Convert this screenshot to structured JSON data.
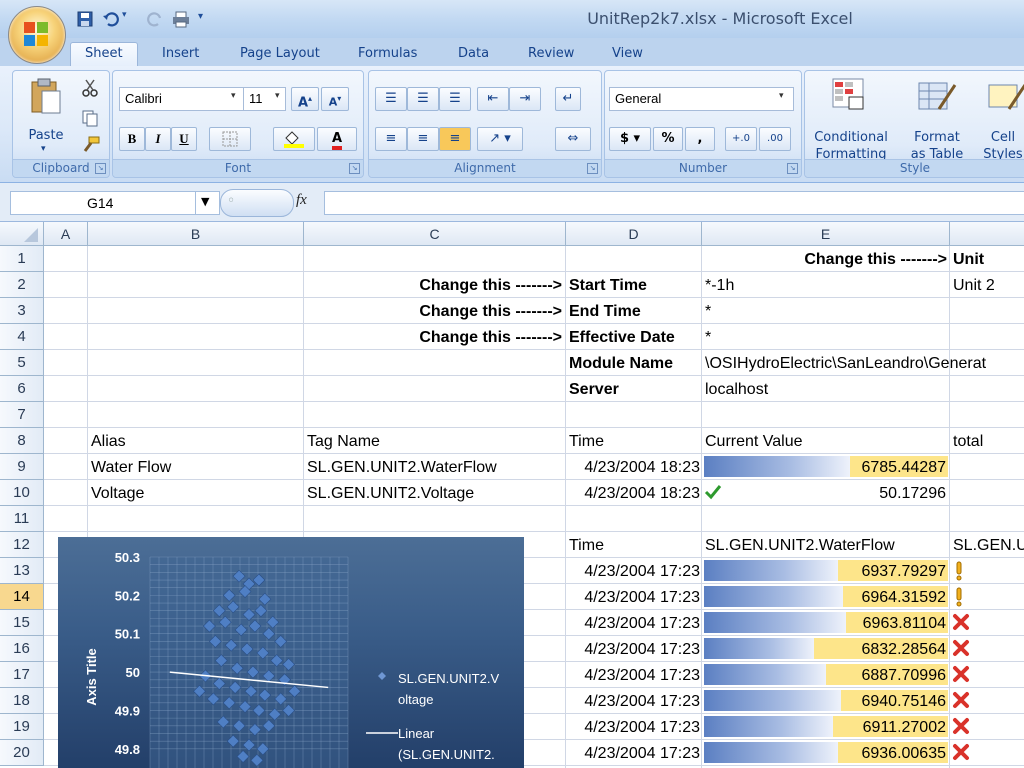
{
  "window": {
    "title": "UnitRep2k7.xlsx - Microsoft Excel"
  },
  "ribbon": {
    "tabs": [
      "Sheet",
      "Insert",
      "Page Layout",
      "Formulas",
      "Data",
      "Review",
      "View"
    ],
    "active_tab": "Sheet",
    "clipboard": {
      "paste_label": "Paste",
      "group_label": "Clipboard"
    },
    "font": {
      "name": "Calibri",
      "size": "11",
      "group_label": "Font",
      "bold": "B",
      "italic": "I",
      "underline": "U"
    },
    "alignment": {
      "group_label": "Alignment"
    },
    "number": {
      "format": "General",
      "currency": "$",
      "percent": "%",
      "comma": ",",
      "group_label": "Number"
    },
    "style": {
      "conditional_1": "Conditional",
      "conditional_2": "Formatting",
      "format_table_1": "Format",
      "format_table_2": "as Table",
      "cell_styles_1": "Cell",
      "cell_styles_2": "Styles",
      "group_label": "Style"
    }
  },
  "formula_bar": {
    "name_box": "G14",
    "fx": "fx",
    "formula": ""
  },
  "grid": {
    "columns": [
      "A",
      "B",
      "C",
      "D",
      "E"
    ],
    "extra_column_partial": "Unit",
    "rows": [
      "1",
      "2",
      "3",
      "4",
      "5",
      "6",
      "7",
      "8",
      "9",
      "10",
      "11",
      "12",
      "13",
      "14",
      "15",
      "16",
      "17",
      "18",
      "19",
      "20"
    ],
    "selected_row": "14",
    "header_block": {
      "r1_e": "Change this ------->",
      "r1_f": "Unit",
      "r2_c": "Change this ------->",
      "r2_d": "Start Time",
      "r2_e": "*-1h",
      "r2_f": "Unit 2",
      "r3_c": "Change this ------->",
      "r3_d": "End Time",
      "r3_e": "*",
      "r4_c": "Change this ------->",
      "r4_d": "Effective Date",
      "r4_e": "*",
      "r5_d": "Module Name",
      "r5_e": "\\OSIHydroElectric\\SanLeandro\\Generat",
      "r6_d": "Server",
      "r6_e": "localhost"
    },
    "table1_headers": {
      "alias": "Alias",
      "tag": "Tag Name",
      "time": "Time",
      "value": "Current Value",
      "total": "total"
    },
    "table1_rows": [
      {
        "alias": "Water Flow",
        "tag": "SL.GEN.UNIT2.WaterFlow",
        "time": "4/23/2004 18:23",
        "value": "6785.44287",
        "bar_fraction": 0.6,
        "icon": "none"
      },
      {
        "alias": "Voltage",
        "tag": "SL.GEN.UNIT2.Voltage",
        "time": "4/23/2004 18:23",
        "value": "50.17296",
        "bar_fraction": 0,
        "icon": "check"
      }
    ],
    "table2_headers": {
      "time": "Time",
      "waterflow": "SL.GEN.UNIT2.WaterFlow",
      "next": "SL.GEN.U"
    },
    "table2_rows": [
      {
        "time": "4/23/2004 17:23",
        "value": "6937.79297",
        "bar_fraction": 0.55,
        "icon": "warning"
      },
      {
        "time": "4/23/2004 17:23",
        "value": "6964.31592",
        "bar_fraction": 0.57,
        "icon": "warning"
      },
      {
        "time": "4/23/2004 17:23",
        "value": "6963.81104",
        "bar_fraction": 0.58,
        "icon": "cross"
      },
      {
        "time": "4/23/2004 17:23",
        "value": "6832.28564",
        "bar_fraction": 0.45,
        "icon": "cross"
      },
      {
        "time": "4/23/2004 17:23",
        "value": "6887.70996",
        "bar_fraction": 0.5,
        "icon": "cross"
      },
      {
        "time": "4/23/2004 17:23",
        "value": "6940.75146",
        "bar_fraction": 0.56,
        "icon": "cross"
      },
      {
        "time": "4/23/2004 17:23",
        "value": "6911.27002",
        "bar_fraction": 0.53,
        "icon": "cross"
      },
      {
        "time": "4/23/2004 17:23",
        "value": "6936.00635",
        "bar_fraction": 0.55,
        "icon": "cross"
      }
    ]
  },
  "chart_data": {
    "type": "scatter",
    "title": "",
    "ylabel": "Axis Title",
    "xlabel": "",
    "ylim": [
      49.75,
      50.3
    ],
    "y_ticks": [
      "50.3",
      "50.2",
      "50.1",
      "50",
      "49.9",
      "49.8"
    ],
    "grid": true,
    "legend_position": "right",
    "legend": [
      {
        "label_1": "SL.GEN.UNIT2.V",
        "label_2": "oltage",
        "marker": "diamond"
      },
      {
        "label_1": "Linear",
        "label_2": "(SL.GEN.UNIT2.",
        "marker": "line"
      }
    ],
    "series": [
      {
        "name": "SL.GEN.UNIT2.Voltage",
        "points": [
          [
            0.45,
            50.25
          ],
          [
            0.5,
            50.23
          ],
          [
            0.55,
            50.24
          ],
          [
            0.4,
            50.2
          ],
          [
            0.48,
            50.21
          ],
          [
            0.58,
            50.19
          ],
          [
            0.35,
            50.16
          ],
          [
            0.42,
            50.17
          ],
          [
            0.5,
            50.15
          ],
          [
            0.56,
            50.16
          ],
          [
            0.62,
            50.13
          ],
          [
            0.3,
            50.12
          ],
          [
            0.38,
            50.13
          ],
          [
            0.46,
            50.11
          ],
          [
            0.53,
            50.12
          ],
          [
            0.6,
            50.1
          ],
          [
            0.66,
            50.08
          ],
          [
            0.33,
            50.08
          ],
          [
            0.41,
            50.07
          ],
          [
            0.49,
            50.06
          ],
          [
            0.57,
            50.05
          ],
          [
            0.64,
            50.03
          ],
          [
            0.7,
            50.02
          ],
          [
            0.36,
            50.03
          ],
          [
            0.44,
            50.01
          ],
          [
            0.52,
            50.0
          ],
          [
            0.6,
            49.99
          ],
          [
            0.68,
            49.98
          ],
          [
            0.28,
            49.99
          ],
          [
            0.35,
            49.97
          ],
          [
            0.43,
            49.96
          ],
          [
            0.51,
            49.95
          ],
          [
            0.58,
            49.94
          ],
          [
            0.66,
            49.93
          ],
          [
            0.73,
            49.95
          ],
          [
            0.25,
            49.95
          ],
          [
            0.32,
            49.93
          ],
          [
            0.4,
            49.92
          ],
          [
            0.48,
            49.91
          ],
          [
            0.55,
            49.9
          ],
          [
            0.63,
            49.89
          ],
          [
            0.7,
            49.9
          ],
          [
            0.37,
            49.87
          ],
          [
            0.45,
            49.86
          ],
          [
            0.53,
            49.85
          ],
          [
            0.6,
            49.86
          ],
          [
            0.42,
            49.82
          ],
          [
            0.5,
            49.81
          ],
          [
            0.57,
            49.8
          ],
          [
            0.47,
            49.78
          ],
          [
            0.54,
            49.77
          ]
        ]
      },
      {
        "name": "Linear (SL.GEN.UNIT2.Voltage)",
        "trend": [
          [
            0.1,
            50.0
          ],
          [
            0.9,
            49.96
          ]
        ]
      }
    ]
  }
}
